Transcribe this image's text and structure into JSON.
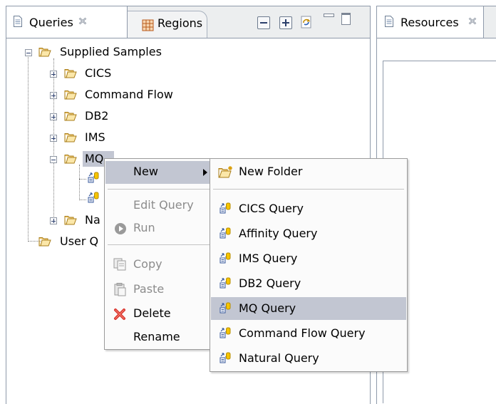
{
  "queries_view": {
    "tabs": [
      {
        "label": "Queries"
      },
      {
        "label": "Regions"
      }
    ],
    "tree": {
      "root": "Supplied Samples",
      "children": [
        "CICS",
        "Command Flow",
        "DB2",
        "IMS",
        "MQ"
      ],
      "mq_children_partial": [
        "",
        ""
      ],
      "natural_partial": "Na",
      "user_partial": "User Q"
    }
  },
  "resources_view": {
    "tab_label": "Resources"
  },
  "context_menu": {
    "new": "New",
    "edit_query": "Edit Query",
    "run": "Run",
    "copy": "Copy",
    "paste": "Paste",
    "delete": "Delete",
    "rename": "Rename"
  },
  "submenu": {
    "new_folder": "New Folder",
    "queries": [
      "CICS Query",
      "Affinity Query",
      "IMS Query",
      "DB2 Query",
      "MQ Query",
      "Command Flow Query",
      "Natural Query"
    ],
    "highlighted": "MQ Query"
  },
  "colors": {
    "folder": "#f2c96d",
    "highlight": "#c2c6d2",
    "delete_icon": "#d9302b"
  }
}
